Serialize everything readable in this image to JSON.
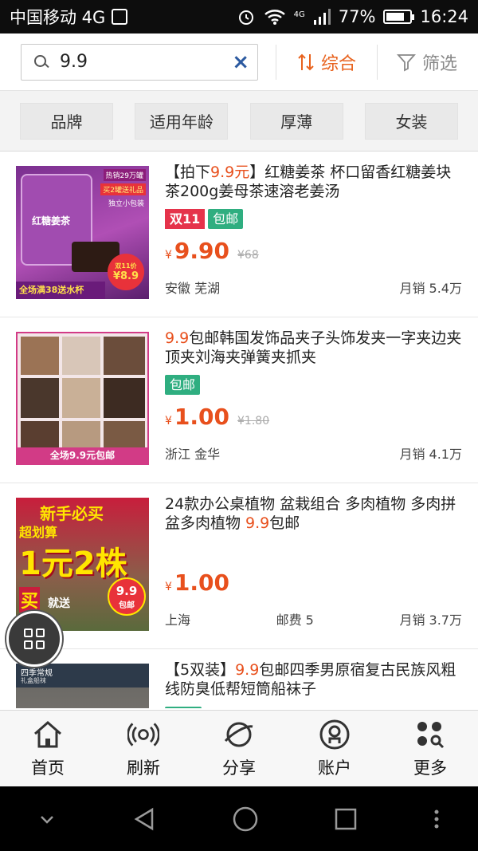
{
  "status": {
    "carrier": "中国移动 4G",
    "net": "4G",
    "battery": "77%",
    "battery_level": 0.77,
    "time": "16:24"
  },
  "search": {
    "value": "9.9",
    "clear": "×"
  },
  "sort": {
    "sort_label": "综合",
    "filter_label": "筛选",
    "accent": "#e8621d"
  },
  "filters": [
    "品牌",
    "适用年龄",
    "厚薄",
    "女装"
  ],
  "products": [
    {
      "title_pre": "【拍下",
      "title_hl": "9.9元",
      "title_post": "】红糖姜茶 杯口留香红糖姜块茶200g姜母茶速溶老姜汤",
      "tag_double11": "双11",
      "tag_free": "包邮",
      "yen": "¥",
      "price": "9.90",
      "orig": "¥68",
      "location": "安徽 芜湖",
      "shipping": "",
      "sales": "月销 5.4万",
      "thumb": {
        "t1": "热销29万罐",
        "t2": "买2罐送礼品",
        "t3": "独立小包装",
        "t4": "红糖姜茶",
        "t5": "双11价",
        "t6": "¥8.9",
        "t7": "全场满38送水杯"
      }
    },
    {
      "title_pre": "",
      "title_hl": "9.9",
      "title_post": "包邮韩国发饰品夹子头饰发夹一字夹边夹顶夹刘海夹弹簧夹抓夹",
      "tag_double11": "",
      "tag_free": "包邮",
      "yen": "¥",
      "price": "1.00",
      "orig": "¥1.80",
      "location": "浙江 金华",
      "shipping": "",
      "sales": "月销 4.1万",
      "thumb": {
        "t1": "全场9.9元包邮"
      }
    },
    {
      "title_pre": "24款办公桌植物 盆栽组合 多肉植物 多肉拼盆多肉植物 ",
      "title_hl": "9.9",
      "title_post": "包邮",
      "tag_double11": "",
      "tag_free": "",
      "yen": "¥",
      "price": "1.00",
      "orig": "",
      "location": "上海",
      "shipping": "邮费 5",
      "sales": "月销 3.7万",
      "thumb": {
        "t1": "新手必买",
        "t2": "超划算",
        "t3": "1元2株",
        "t4": "买",
        "t5": "就送",
        "t6": "9.9",
        "t7": "包邮"
      }
    },
    {
      "title_pre": "【5双装】",
      "title_hl": "9.9",
      "title_post": "包邮四季男原宿复古民族风粗线防臭低帮短筒船袜子",
      "tag_double11": "",
      "tag_free": "",
      "yen": "",
      "price": "",
      "orig": "",
      "location": "",
      "shipping": "",
      "sales": "",
      "thumb": {
        "t1": "四季常规",
        "t2": "礼盒船袜"
      }
    }
  ],
  "tabs": [
    {
      "label": "首页",
      "icon": "home-icon"
    },
    {
      "label": "刷新",
      "icon": "refresh-icon"
    },
    {
      "label": "分享",
      "icon": "share-icon"
    },
    {
      "label": "账户",
      "icon": "account-icon"
    },
    {
      "label": "更多",
      "icon": "more-icon"
    }
  ]
}
